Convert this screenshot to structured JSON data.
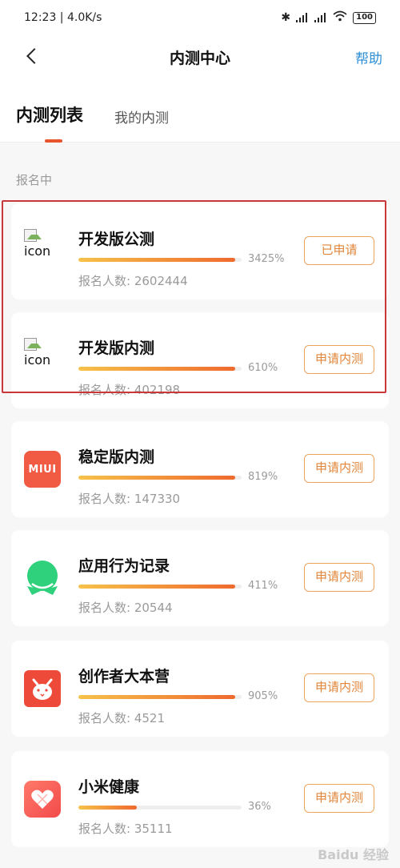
{
  "status_bar": {
    "time_speed": "12:23 | 4.0K/s",
    "battery": "100"
  },
  "nav": {
    "title": "内测中心",
    "help": "帮助"
  },
  "tabs": {
    "active": "内测列表",
    "other": "我的内测"
  },
  "section_label": "报名中",
  "broken_icon_alt": "icon",
  "items": [
    {
      "title": "开发版公测",
      "progress_label": "3425%",
      "progress_fill": 0.96,
      "count": "报名人数: 2602444",
      "button": "已申请",
      "icon": "broken-image-icon"
    },
    {
      "title": "开发版内测",
      "progress_label": "610%",
      "progress_fill": 0.96,
      "count": "报名人数: 402198",
      "button": "申请内测",
      "icon": "broken-image-icon"
    },
    {
      "title": "稳定版内测",
      "progress_label": "819%",
      "progress_fill": 0.96,
      "count": "报名人数: 147330",
      "button": "申请内测",
      "icon": "miui-logo-icon",
      "icon_text": "MIUI"
    },
    {
      "title": "应用行为记录",
      "progress_label": "411%",
      "progress_fill": 0.96,
      "count": "报名人数: 20544",
      "button": "申请内测",
      "icon": "green-badge-icon"
    },
    {
      "title": "创作者大本营",
      "progress_label": "905%",
      "progress_fill": 0.96,
      "count": "报名人数: 4521",
      "button": "申请内测",
      "icon": "bunny-icon"
    },
    {
      "title": "小米健康",
      "progress_label": "36%",
      "progress_fill": 0.36,
      "count": "报名人数: 35111",
      "button": "申请内测",
      "icon": "heart-icon"
    }
  ],
  "colors": {
    "accent_orange": "#e0853a",
    "help_blue": "#2d8fd5",
    "tab_indicator": "#e8542c",
    "highlight_red": "#c8383a"
  },
  "watermark": "Baidu 经验"
}
